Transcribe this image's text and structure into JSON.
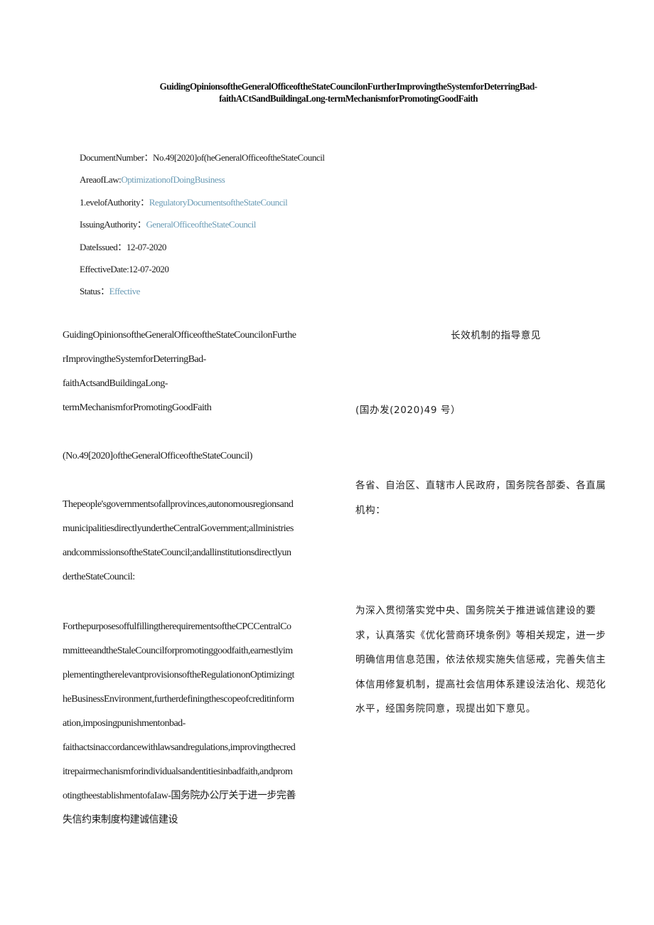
{
  "document": {
    "title_lines": [
      "GuidingOpinionsoftheGeneralOfficeoftheStateCouncilonFurtherImprovingtheSystemforDeterringBad-",
      "faithACtSandBuildingaLong-termMechanismforPromotingGoodFaith"
    ]
  },
  "metadata": {
    "document_number": {
      "label": "DocumentNumber：",
      "value": "No.49[2020]of(heGeneralOfficeoftheStateCouncil"
    },
    "area_of_law": {
      "label": "AreaofLaw:",
      "value": "OptimizationofDoingBusiness"
    },
    "level_of_authority": {
      "label": "1.evelofAuthority：",
      "value": "RegulatoryDocumentsoftheStateCouncil"
    },
    "issuing_authority": {
      "label": "IssuingAuthority：",
      "value": "GeneralOfficeoftheStateCouncil"
    },
    "date_issued": {
      "label": "DateIssued：",
      "value": "12-07-2020"
    },
    "effective_date": {
      "label": "EffectiveDate:",
      "value": "12-07-2020"
    },
    "status": {
      "label": "Status：",
      "value": "Effective"
    },
    "link_color": "#6a9bb5"
  },
  "english": {
    "title_lines": [
      "GuidingOpinionsoftheGeneralOfficeoftheStateCouncilonFurthe",
      "rImprovingtheSystemforDeterringBad-",
      "faithActsandBuildingaLong-",
      "termMechanismforPromotingGoodFaith"
    ],
    "doc_number": "(No.49[2020]oftheGeneralOfficeoftheStateCouncil)",
    "addressee_lines": [
      "Thepeople'sgovernmentsofallprovinces,autonomousregionsand",
      "municipalitiesdirectlyundertheCentralGovernment;allministries",
      "andcommissionsoftheStateCouncil;andallinstitutionsdirectlyun",
      "dertheStateCouncil:"
    ],
    "body_lines": [
      "ForthepurposesoffulfillingtherequirementsoftheCPCCentralCo",
      "mmitteeandtheStaleCouncilforpromotinggoodfaith,earnestlyim",
      "plementingtherelevantprovisionsoftheRegulationonOptimizingt",
      "heBusinessEnvironment,furtherdefiningthescopeofcreditinform",
      "ation,imposingpunishmentonbad-",
      "faithactsinaccordancewithlawsandregulations,improvingthecred",
      "itrepairmechanismforindividualsandentitiesinbadfaith,andprom",
      "otingtheestablishmentofaIaw-国务院办公厅关于进一步完善",
      "失信约束制度构建诚信建设"
    ]
  },
  "chinese": {
    "title": "长效机制的指导意见",
    "doc_number": "(国办发(2020)49 号）",
    "addressee_lines": [
      "各省、自治区、直辖市人民政府，国务院各部委、各直属",
      "机构："
    ],
    "body_lines": [
      "为深入贯彻落实党中央、国务院关于推进诚信建设的要",
      "求，认真落实《优化营商环境条例》等相关规定，进一步",
      "明确信用信息范围，依法依规实施失信惩戒，完善失信主",
      "体信用修复机制，提高社会信用体系建设法治化、规范化",
      "水平，经国务院同意，现提出如下意见。"
    ]
  }
}
